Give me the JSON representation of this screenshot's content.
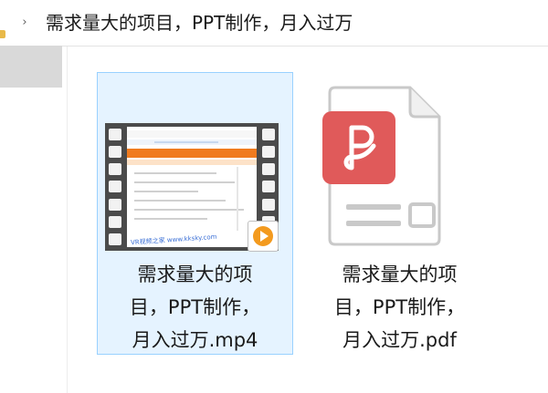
{
  "breadcrumb": {
    "separator": "›",
    "current_folder": "需求量大的项目，PPT制作，月入过万"
  },
  "files": [
    {
      "name": "需求量大的项目，PPT制作，月入过万.mp4",
      "label_lines": [
        "需求量大的项",
        "目，PPT制作，",
        "月入过万.mp4"
      ],
      "type": "video",
      "icon": "video-thumbnail-icon",
      "selected": true,
      "thumbnail_watermark": "VR视频之家 www.kksky.com"
    },
    {
      "name": "需求量大的项目，PPT制作，月入过万.pdf",
      "label_lines": [
        "需求量大的项",
        "目，PPT制作，",
        "月入过万.pdf"
      ],
      "type": "pdf",
      "icon": "pdf-file-icon",
      "selected": false
    }
  ],
  "colors": {
    "selection_fill": "#e5f3ff",
    "selection_border": "#99d1ff",
    "pdf_badge": "#e05a5a",
    "play_badge": "#f39a1e",
    "folder": "#e8b949"
  }
}
